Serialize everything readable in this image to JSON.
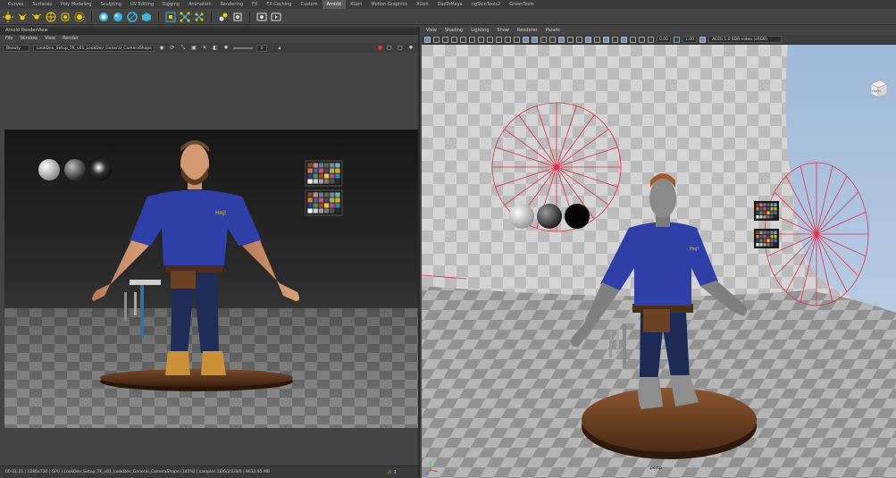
{
  "shelf": {
    "tabs": [
      "Curves",
      "Surfaces",
      "Poly Modeling",
      "Sculpting",
      "UV Editing",
      "Rigging",
      "Animation",
      "Rendering",
      "FX",
      "FX Caching",
      "Custom",
      "Arnold",
      "XGen",
      "Motion Graphics",
      "XGen",
      "DazToMaya",
      "ngSkinTools2",
      "GreenTools"
    ],
    "active_tab": "Arnold"
  },
  "render_view": {
    "title": "Arnold RenderView",
    "menu": [
      "File",
      "Window",
      "View",
      "Render"
    ],
    "aov_dropdown": "Beauty",
    "camera_dropdown": "LookDev_Setup_TK_v01_LookDev_General_CameraShape",
    "exposure_value": "0",
    "status_text": "00:01:21 | 1280x720 | GPU | LookDev_Setup_TK_v01_LookDev_General_CameraShape (141%) | samples 16/6/2/2/4/0 | 9632.95 MB",
    "warning_count": "1"
  },
  "viewport": {
    "menu": [
      "View",
      "Shading",
      "Lighting",
      "Show",
      "Renderer",
      "Panels"
    ],
    "field_exposure": "0.00",
    "field_gamma": "1.00",
    "color_space": "ACES 1.0 SDR-video (sRGB)",
    "view_cube_label": "FRONT",
    "camera_label": "persp"
  },
  "colors": {
    "accent": "#6b8fb5",
    "shirt": "#2f3fa8",
    "jeans": "#1d2a55",
    "light_gizmo": "#e0304a",
    "warning": "#e8c000"
  }
}
